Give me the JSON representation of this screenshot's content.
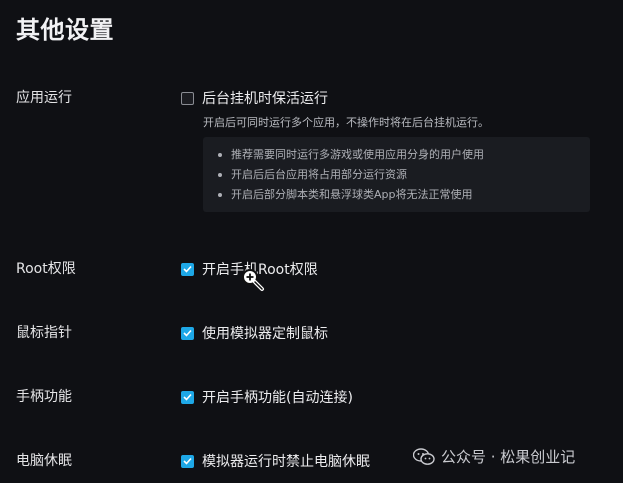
{
  "page": {
    "title": "其他设置"
  },
  "app_run": {
    "label": "应用运行",
    "option": "后台挂机时保活运行",
    "checked": false,
    "description": "开启后可同时运行多个应用，不操作时将在后台挂机运行。",
    "tips": [
      "推荐需要同时运行多游戏或使用应用分身的用户使用",
      "开启后后台应用将占用部分运行资源",
      "开启后部分脚本类和悬浮球类App将无法正常使用"
    ]
  },
  "root": {
    "label": "Root权限",
    "option": "开启手机Root权限",
    "checked": true
  },
  "mouse": {
    "label": "鼠标指针",
    "option": "使用模拟器定制鼠标",
    "checked": true
  },
  "gamepad": {
    "label": "手柄功能",
    "option": "开启手柄功能(自动连接)",
    "checked": true
  },
  "sleep": {
    "label": "电脑休眠",
    "option": "模拟器运行时禁止电脑休眠",
    "checked": true
  },
  "watermark": {
    "text": "公众号 · 松果创业记"
  },
  "colors": {
    "background": "#0f1014",
    "accent": "#1ea8e7",
    "tip_box": "#1a1c21"
  },
  "icons": {
    "checkbox_checked": "check-mark",
    "cursor": "zoom-in-magnifier",
    "watermark": "wechat-icon"
  }
}
